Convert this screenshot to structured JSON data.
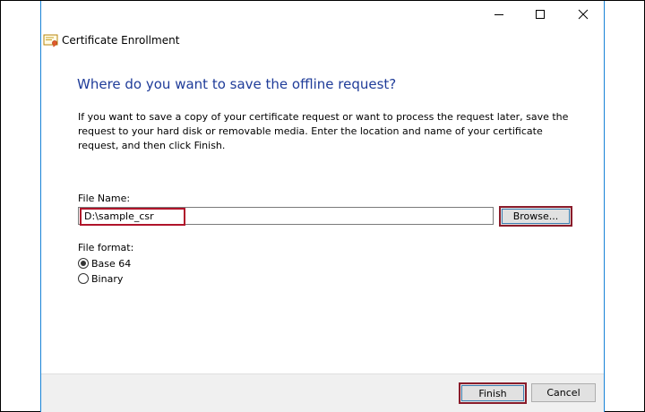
{
  "window": {
    "title": "Certificate Enrollment",
    "icons": {
      "app": "certificate-icon",
      "minimize": "minimize-icon",
      "maximize": "maximize-icon",
      "close": "close-icon"
    }
  },
  "page": {
    "heading": "Where do you want to save the offline request?",
    "instructions": "If you want to save a copy of your certificate request or want to process the request later, save the request to your hard disk or removable media. Enter the location and name of your certificate request, and then click Finish."
  },
  "file_name": {
    "label": "File Name:",
    "value": "D:\\sample_csr",
    "browse_label": "Browse..."
  },
  "file_format": {
    "label": "File format:",
    "options": [
      {
        "label": "Base 64",
        "selected": true
      },
      {
        "label": "Binary",
        "selected": false
      }
    ]
  },
  "footer": {
    "finish_label": "Finish",
    "cancel_label": "Cancel"
  },
  "colors": {
    "heading": "#1f3c99",
    "highlight": "#b0142a",
    "window_border": "#1883d7",
    "footer_bg": "#f0f0f0"
  }
}
